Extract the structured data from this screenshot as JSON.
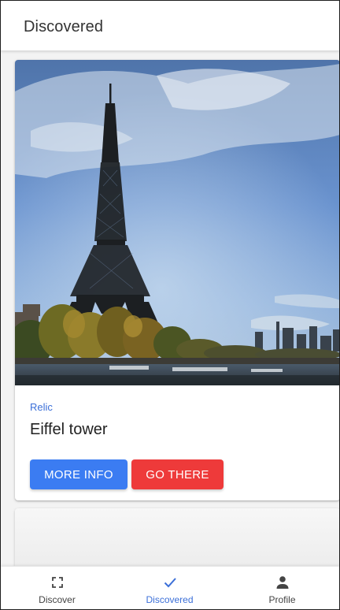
{
  "header": {
    "title": "Discovered"
  },
  "card": {
    "image_alt": "Eiffel tower photo",
    "category": "Relic",
    "title": "Eiffel tower",
    "more_info_label": "MORE INFO",
    "go_there_label": "GO THERE"
  },
  "bottom_nav": {
    "items": [
      {
        "label": "Discover",
        "icon": "scan-frame-icon",
        "active": false
      },
      {
        "label": "Discovered",
        "icon": "checkmark-icon",
        "active": true
      },
      {
        "label": "Profile",
        "icon": "person-icon",
        "active": false
      }
    ]
  },
  "colors": {
    "accent_blue": "#3b7cf2",
    "accent_red": "#ee3a3a",
    "active_nav": "#3b6fd8"
  }
}
